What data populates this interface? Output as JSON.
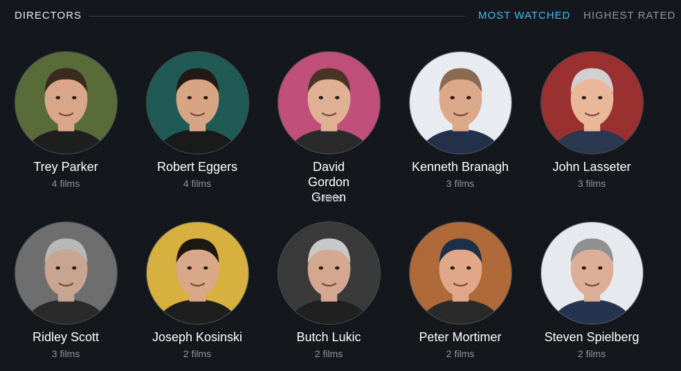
{
  "header": {
    "title": "DIRECTORS",
    "tabs": [
      {
        "label": "MOST WATCHED",
        "active": true
      },
      {
        "label": "HIGHEST RATED",
        "active": false
      }
    ]
  },
  "colors": {
    "background": "#14181c",
    "accent": "#40bcf4",
    "muted": "#8c96a0"
  },
  "directors": [
    {
      "name": "Trey Parker",
      "films": "4 films",
      "bg": "#5a6b3a",
      "skin": "#d9a68a",
      "hair": "#3b2a1e",
      "shirt": "#1f1f1f"
    },
    {
      "name": "Robert Eggers",
      "films": "4 films",
      "bg": "#1f5a55",
      "skin": "#d8a584",
      "hair": "#231a15",
      "shirt": "#1a1a1a"
    },
    {
      "name": "David Gordon Green",
      "films": "3 films",
      "bg": "#c0507a",
      "skin": "#e0b095",
      "hair": "#4a3426",
      "shirt": "#2a2a2a"
    },
    {
      "name": "Kenneth Branagh",
      "films": "3 films",
      "bg": "#e8ecf0",
      "skin": "#dca88a",
      "hair": "#8a6a50",
      "shirt": "#23304a"
    },
    {
      "name": "John Lasseter",
      "films": "3 films",
      "bg": "#9a3030",
      "skin": "#eab79a",
      "hair": "#d0d0d0",
      "shirt": "#2a3850"
    },
    {
      "name": "Ridley Scott",
      "films": "3 films",
      "bg": "#6e6e6e",
      "skin": "#c7a590",
      "hair": "#b8b8b8",
      "shirt": "#2a2a2a"
    },
    {
      "name": "Joseph Kosinski",
      "films": "2 films",
      "bg": "#d8b040",
      "skin": "#d8a888",
      "hair": "#1e1712",
      "shirt": "#1e1e1e"
    },
    {
      "name": "Butch Lukic",
      "films": "2 films",
      "bg": "#3a3a3a",
      "skin": "#d4a890",
      "hair": "#c8c8c8",
      "shirt": "#202020"
    },
    {
      "name": "Peter Mortimer",
      "films": "2 films",
      "bg": "#b06a3a",
      "skin": "#e0a888",
      "hair": "#1e3048",
      "shirt": "#2a2a2a"
    },
    {
      "name": "Steven Spielberg",
      "films": "2 films",
      "bg": "#e6eaee",
      "skin": "#dcae98",
      "hair": "#909090",
      "shirt": "#24344e"
    }
  ]
}
